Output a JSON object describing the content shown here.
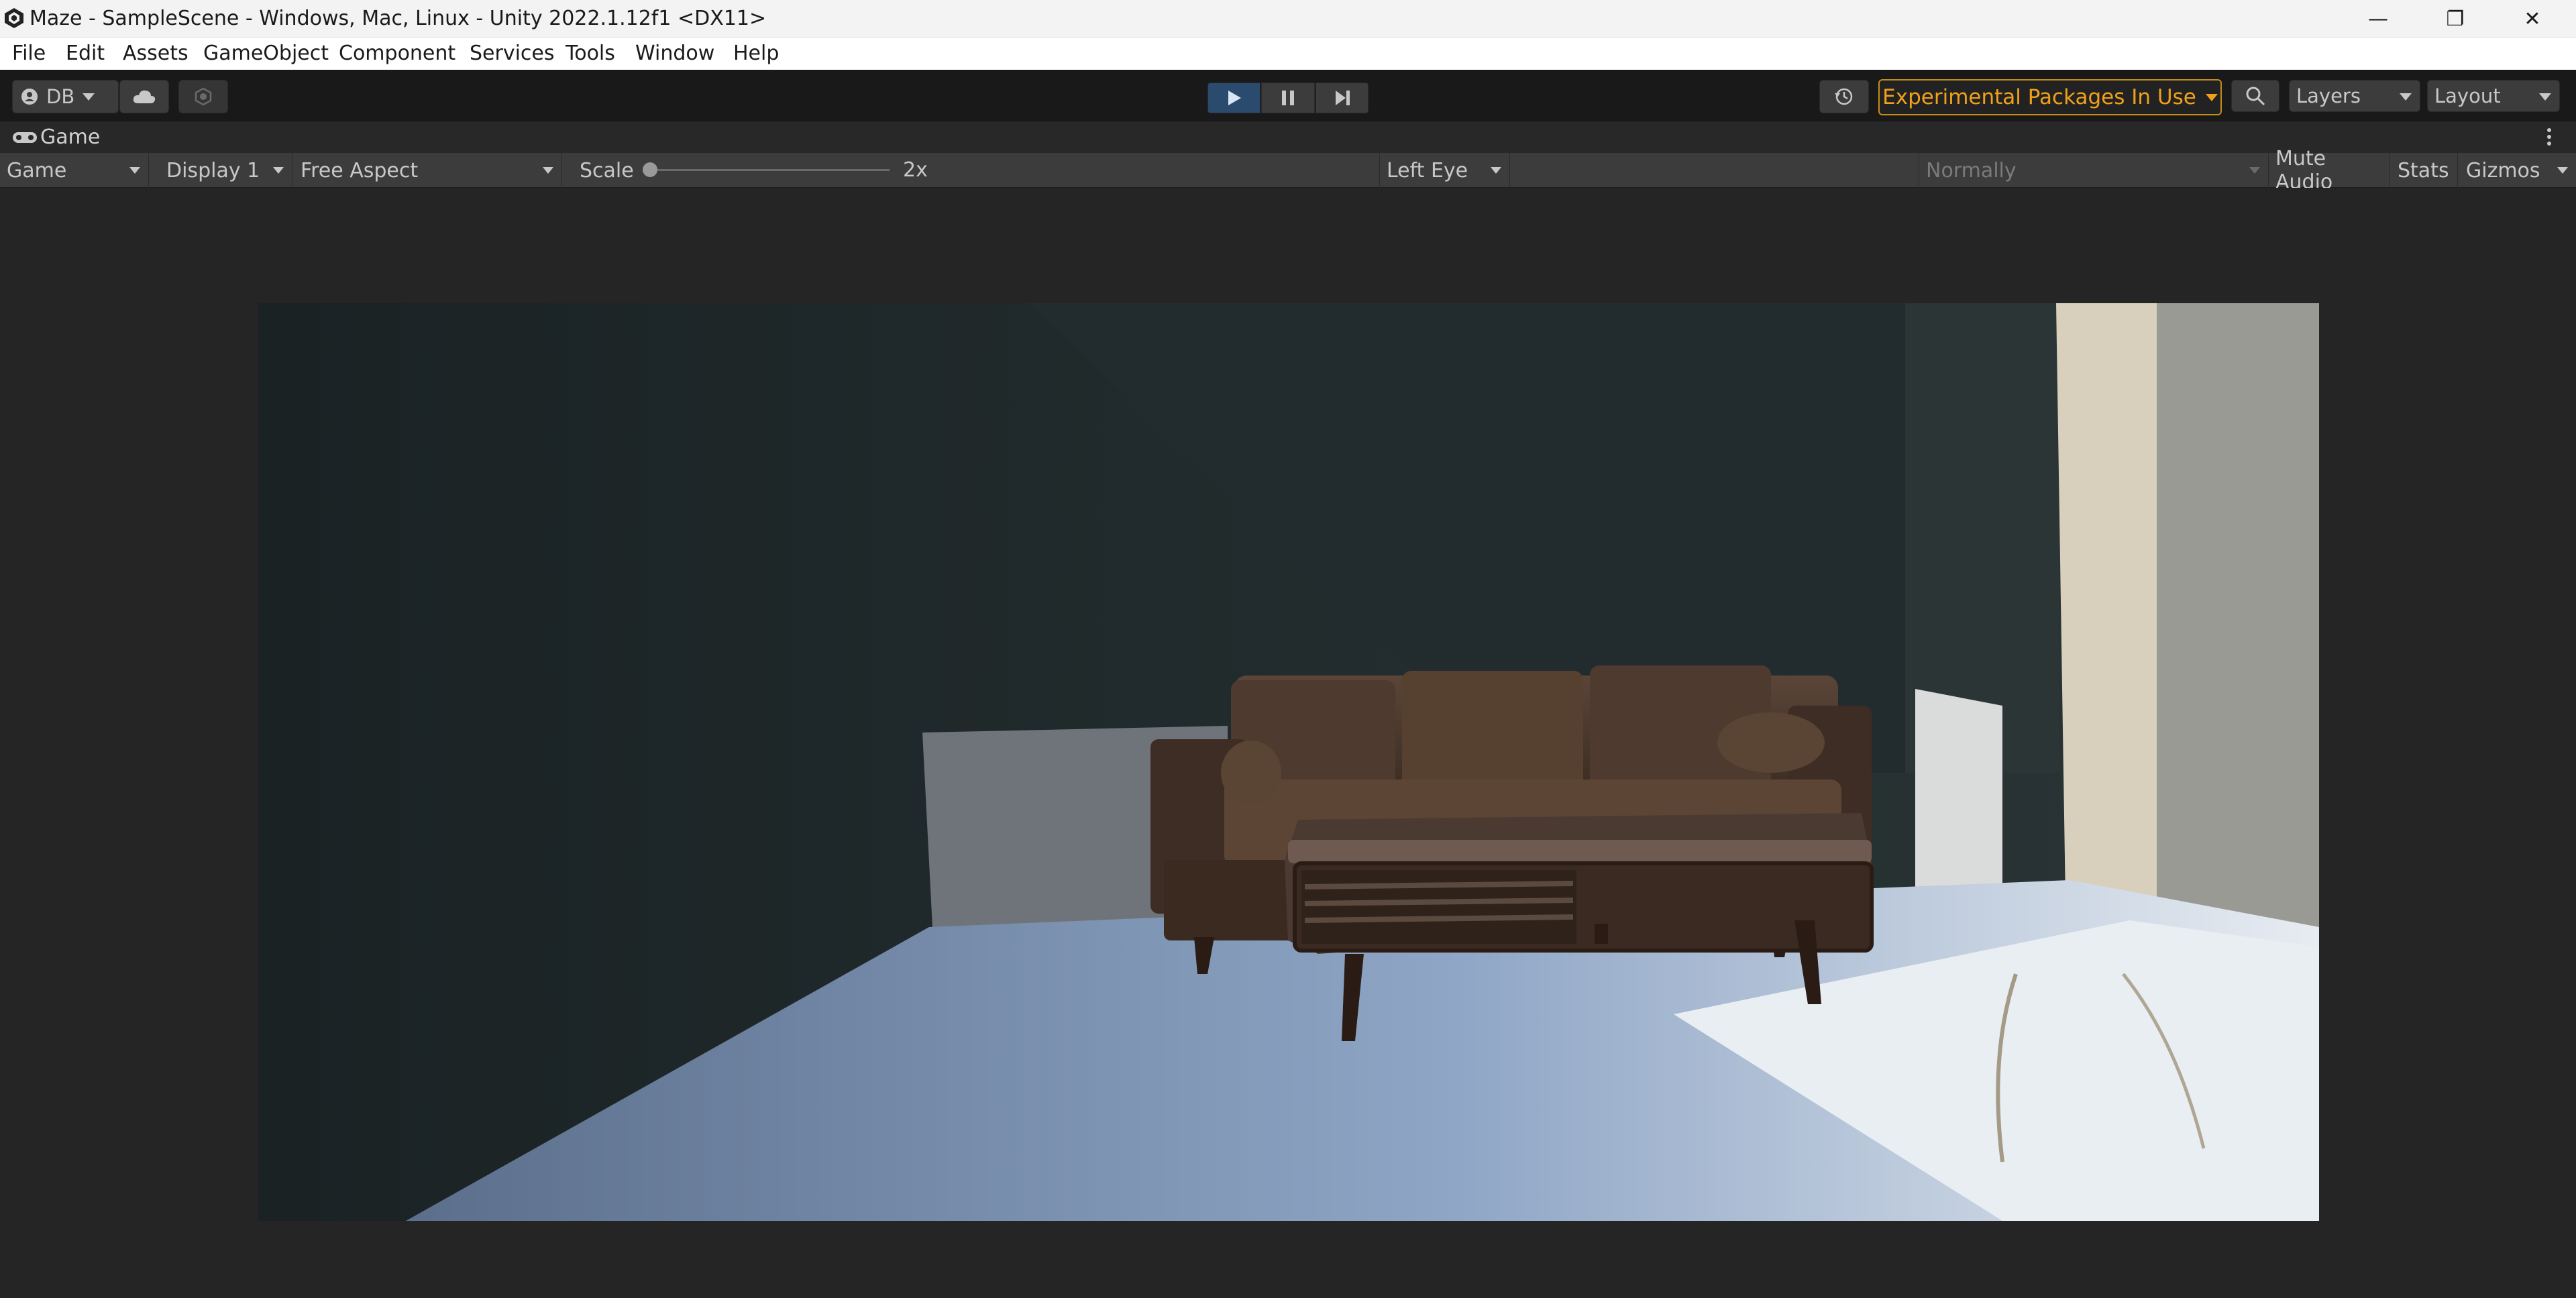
{
  "window": {
    "title": "Maze - SampleScene - Windows, Mac, Linux - Unity 2022.1.12f1 <DX11>",
    "controls": {
      "minimize": "—",
      "restore": "❐",
      "close": "✕"
    }
  },
  "menu": [
    "File",
    "Edit",
    "Assets",
    "GameObject",
    "Component",
    "Services",
    "Tools",
    "Window",
    "Help"
  ],
  "toolbar": {
    "account_label": "DB",
    "experimental_packages": "Experimental Packages In Use",
    "layers_label": "Layers",
    "layout_label": "Layout"
  },
  "game_tab": {
    "label": "Game"
  },
  "game_bar": {
    "view_mode": "Game",
    "display": "Display 1",
    "aspect": "Free Aspect",
    "scale_label": "Scale",
    "scale_value": "2x",
    "eye": "Left Eye",
    "play_focus": "Normally",
    "mute_audio": "Mute Audio",
    "stats": "Stats",
    "gizmos": "Gizmos"
  },
  "colors": {
    "play_active": "#2a4a6e",
    "warning_accent": "#f0a11a",
    "editor_bg": "#252525",
    "toolbar_bg": "#191919"
  },
  "icons": {
    "unity_logo": "unity-logo-icon",
    "account": "account-icon",
    "cloud": "cloud-icon",
    "collab": "collab-icon",
    "play": "play-icon",
    "pause": "pause-icon",
    "step": "step-icon",
    "history": "history-icon",
    "search": "search-icon",
    "game_tab": "gamepad-icon",
    "kebab": "kebab-menu-icon"
  }
}
